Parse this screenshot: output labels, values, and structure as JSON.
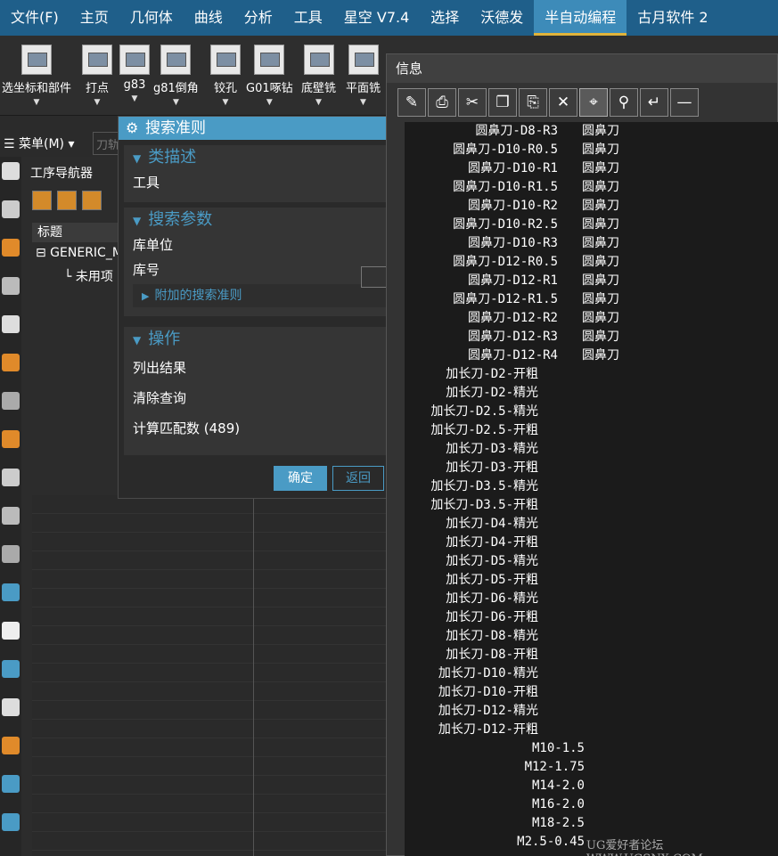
{
  "menubar": {
    "items": [
      "文件(F)",
      "主页",
      "几何体",
      "曲线",
      "分析",
      "工具",
      "星空 V7.4",
      "选择",
      "沃德发",
      "半自动编程",
      "古月软件 2"
    ],
    "active_index": 9
  },
  "ribbon": {
    "buttons": [
      {
        "label": "选坐标和部件",
        "icon": "coordinate-select-icon"
      },
      {
        "label": "打点",
        "icon": "point-icon"
      },
      {
        "label": "g83",
        "icon": "g83-drill-icon"
      },
      {
        "label": "g81倒角",
        "icon": "g81-chamfer-icon"
      },
      {
        "label": "铰孔",
        "icon": "ream-icon"
      },
      {
        "label": "G01啄钻",
        "icon": "peck-drill-icon"
      },
      {
        "label": "底壁铣",
        "icon": "floor-wall-mill-icon"
      },
      {
        "label": "平面铣",
        "icon": "planar-mill-icon"
      }
    ]
  },
  "toolbar2": {
    "menu_label": "☰ 菜单(M) ▾",
    "filter_text": "刀轨"
  },
  "navigator": {
    "title": "工序导航器",
    "column_header": "标题",
    "tree_root": "⊟ GENERIC_M",
    "tree_child": "└ 未用项"
  },
  "search_dialog": {
    "title": "搜索准则",
    "sections": {
      "class_desc": {
        "header": "类描述",
        "value": "工具"
      },
      "search_params": {
        "header": "搜索参数",
        "lib_unit": "库单位",
        "lib_no": "库号",
        "extra": "附加的搜索准则"
      },
      "actions": {
        "header": "操作",
        "list": "列出结果",
        "clear": "清除查询",
        "count": "计算匹配数 (489)"
      }
    },
    "ok_label": "确定",
    "back_label": "返回"
  },
  "info_window": {
    "title": "信息",
    "lines": [
      {
        "name": "圆鼻刀-D8-R3",
        "type": "圆鼻刀"
      },
      {
        "name": "圆鼻刀-D10-R0.5",
        "type": "圆鼻刀"
      },
      {
        "name": "圆鼻刀-D10-R1",
        "type": "圆鼻刀"
      },
      {
        "name": "圆鼻刀-D10-R1.5",
        "type": "圆鼻刀"
      },
      {
        "name": "圆鼻刀-D10-R2",
        "type": "圆鼻刀"
      },
      {
        "name": "圆鼻刀-D10-R2.5",
        "type": "圆鼻刀"
      },
      {
        "name": "圆鼻刀-D10-R3",
        "type": "圆鼻刀"
      },
      {
        "name": "圆鼻刀-D12-R0.5",
        "type": "圆鼻刀"
      },
      {
        "name": "圆鼻刀-D12-R1",
        "type": "圆鼻刀"
      },
      {
        "name": "圆鼻刀-D12-R1.5",
        "type": "圆鼻刀"
      },
      {
        "name": "圆鼻刀-D12-R2",
        "type": "圆鼻刀"
      },
      {
        "name": "圆鼻刀-D12-R3",
        "type": "圆鼻刀"
      },
      {
        "name": "圆鼻刀-D12-R4",
        "type": "圆鼻刀"
      },
      {
        "name": "加长刀-D2-开粗",
        "type": ""
      },
      {
        "name": "加长刀-D2-精光",
        "type": ""
      },
      {
        "name": "加长刀-D2.5-精光",
        "type": ""
      },
      {
        "name": "加长刀-D2.5-开粗",
        "type": ""
      },
      {
        "name": "加长刀-D3-精光",
        "type": ""
      },
      {
        "name": "加长刀-D3-开粗",
        "type": ""
      },
      {
        "name": "加长刀-D3.5-精光",
        "type": ""
      },
      {
        "name": "加长刀-D3.5-开粗",
        "type": ""
      },
      {
        "name": "加长刀-D4-精光",
        "type": ""
      },
      {
        "name": "加长刀-D4-开粗",
        "type": ""
      },
      {
        "name": "加长刀-D5-精光",
        "type": ""
      },
      {
        "name": "加长刀-D5-开粗",
        "type": ""
      },
      {
        "name": "加长刀-D6-精光",
        "type": ""
      },
      {
        "name": "加长刀-D6-开粗",
        "type": ""
      },
      {
        "name": "加长刀-D8-精光",
        "type": ""
      },
      {
        "name": "加长刀-D8-开粗",
        "type": ""
      },
      {
        "name": "加长刀-D10-精光",
        "type": ""
      },
      {
        "name": "加长刀-D10-开粗",
        "type": ""
      },
      {
        "name": "加长刀-D12-精光",
        "type": ""
      },
      {
        "name": "加长刀-D12-开粗",
        "type": ""
      },
      {
        "name": "M10-1.5",
        "type": ""
      },
      {
        "name": "M12-1.75",
        "type": ""
      },
      {
        "name": "M14-2.0",
        "type": ""
      },
      {
        "name": "M16-2.0",
        "type": ""
      },
      {
        "name": "M18-2.5",
        "type": ""
      },
      {
        "name": "M2.5-0.45",
        "type": ""
      }
    ]
  },
  "watermark": "UG爱好者论坛 WWW.UGSNX.COM",
  "colors": {
    "accent": "#4a9bc5",
    "menubar": "#1f5f8a",
    "highlight": "#e0b33a"
  }
}
